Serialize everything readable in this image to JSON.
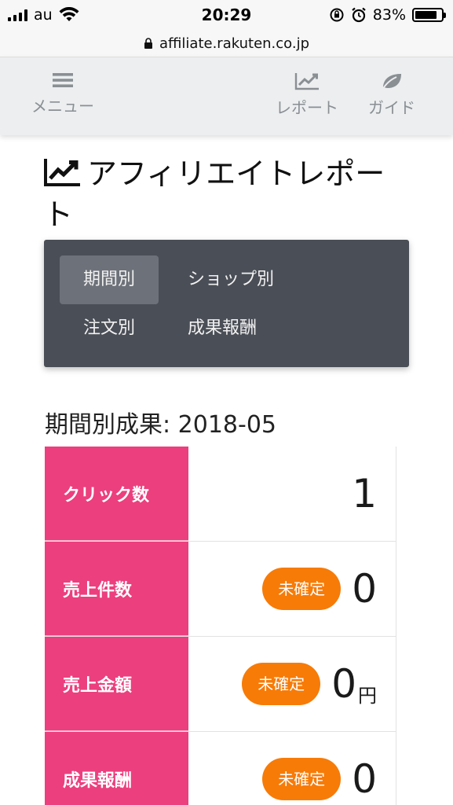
{
  "status_bar": {
    "carrier": "au",
    "time": "20:29",
    "battery": "83%",
    "battery_level": 0.83
  },
  "url_bar": {
    "url": "affiliate.rakuten.co.jp"
  },
  "nav": {
    "menu_label": "メニュー",
    "report_label": "レポート",
    "guide_label": "ガイド"
  },
  "page": {
    "title": "アフィリエイトレポート"
  },
  "tabs": [
    {
      "label": "期間別",
      "active": true
    },
    {
      "label": "ショップ別",
      "active": false
    },
    {
      "label": "注文別",
      "active": false
    },
    {
      "label": "成果報酬",
      "active": false
    }
  ],
  "period": {
    "heading": "期間別成果: 2018-05"
  },
  "results": [
    {
      "label": "クリック数",
      "badge": "",
      "value": "1",
      "unit": ""
    },
    {
      "label": "売上件数",
      "badge": "未確定",
      "value": "0",
      "unit": ""
    },
    {
      "label": "売上金額",
      "badge": "未確定",
      "value": "0",
      "unit": "円"
    },
    {
      "label": "成果報酬",
      "badge": "未確定",
      "value": "0",
      "unit": ""
    }
  ],
  "colors": {
    "label_bg": "#ec3f7d",
    "badge_bg": "#f77b07",
    "tab_panel_bg": "#4a4e56",
    "tab_active_bg": "#6d7179"
  },
  "icons": {
    "menu": "hamburger-icon",
    "report": "line-chart-icon",
    "guide": "leaf-icon",
    "title": "line-chart-icon"
  }
}
